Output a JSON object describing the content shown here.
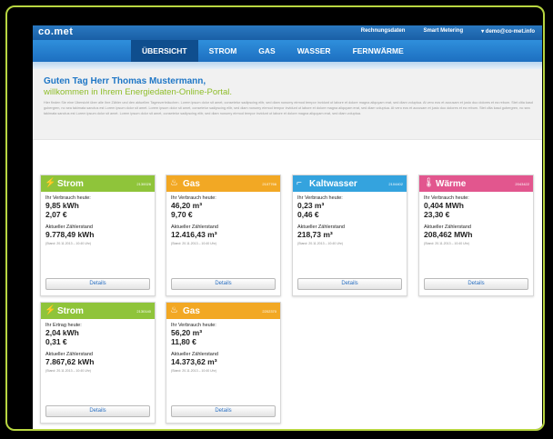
{
  "app": {
    "logo": "co.met"
  },
  "topbar": {
    "links": [
      "Rechnungsdaten",
      "Smart Metering",
      "▾ demo@co-met.info"
    ]
  },
  "nav": {
    "items": [
      "ÜBERSICHT",
      "STROM",
      "GAS",
      "WASSER",
      "FERNWÄRME"
    ],
    "active": 0
  },
  "intro": {
    "greeting": "Guten Tag Herr Thomas Mustermann,",
    "welcome": "willkommen in Ihrem Energiedaten-Online-Portal.",
    "lead": "Hier finden Sie eine Übersicht über alle Ihre Zähler und den aktuellen Tagesverbräuchen. Lorem ipsum dolor sit amet, consetetur sadipscing elitr, sed diam nonumy eirmod tempor invidunt ut labore et dolore magna aliquyam erat, sed diam voluptua. At vero eos et accusam et justo duo dolores et ea rebum. Stet clita kasd gubergren, no sea takimata sanctus est Lorem ipsum dolor sit amet. Lorem ipsum dolor sit amet, consetetur sadipscing elitr, sed diam nonumy eirmod tempor invidunt ut labore et dolore magna aliquyam erat, sed diam voluptua. At vero eos et accusam et justo duo dolores et ea rebum. Stet clita kasd gubergren, no sea takimata sanctus est Lorem ipsum dolor sit amet. Lorem ipsum dolor sit amet, consetetur sadipscing elitr, sed diam nonumy eirmod tempor invidunt ut labore et dolore magna aliquyam erat, sed diam voluptua."
  },
  "cards": [
    {
      "title": "Strom",
      "id": "2130026",
      "color": "#8fc43a",
      "icon": "plug-icon",
      "label1": "Ihr Verbrauch heute:",
      "v1": "9,85 kWh",
      "v2": "2,07 €",
      "label2": "Aktueller Zählerstand",
      "v3": "9.778,49 kWh",
      "note": "(Stand: 20.11.2013 – 10:40 Uhr)",
      "button": "Details"
    },
    {
      "title": "Gas",
      "id": "2107766",
      "color": "#f2a824",
      "icon": "flame-icon",
      "label1": "Ihr Verbrauch heute:",
      "v1": "46,20 m³",
      "v2": "9,70 €",
      "label2": "Aktueller Zählerstand",
      "v3": "12.416,43 m³",
      "note": "(Stand: 20.11.2013 – 10:40 Uhr)",
      "button": "Details"
    },
    {
      "title": "Kaltwasser",
      "id": "2104402",
      "color": "#34a3de",
      "icon": "faucet-icon",
      "label1": "Ihr Verbrauch heute:",
      "v1": "0,23 m³",
      "v2": "0,46 €",
      "label2": "Aktueller Zählerstand",
      "v3": "218,73 m³",
      "note": "(Stand: 20.11.2013 – 10:40 Uhr)",
      "button": "Details"
    },
    {
      "title": "Wärme",
      "id": "2043422",
      "color": "#e2568e",
      "icon": "thermometer-icon",
      "label1": "Ihr Verbrauch heute:",
      "v1": "0,404 MWh",
      "v2": "23,30 €",
      "label2": "Aktueller Zählerstand",
      "v3": "208,462 MWh",
      "note": "(Stand: 20.11.2013 – 10:40 Uhr)",
      "button": "Details"
    },
    {
      "title": "Strom",
      "id": "2130140",
      "color": "#8fc43a",
      "icon": "plug-icon",
      "label1": "Ihr Ertrag heute:",
      "v1": "2,04 kWh",
      "v2": "0,31 €",
      "label2": "Aktueller Zählerstand",
      "v3": "7.867,62 kWh",
      "note": "(Stand: 20.11.2013 – 10:40 Uhr)",
      "button": "Details"
    },
    {
      "title": "Gas",
      "id": "2202370",
      "color": "#f2a824",
      "icon": "flame-icon",
      "label1": "Ihr Verbrauch heute:",
      "v1": "56,20 m³",
      "v2": "11,80 €",
      "label2": "Aktueller Zählerstand",
      "v3": "14.373,62 m³",
      "note": "(Stand: 20.11.2013 – 10:40 Uhr)",
      "button": "Details"
    }
  ]
}
